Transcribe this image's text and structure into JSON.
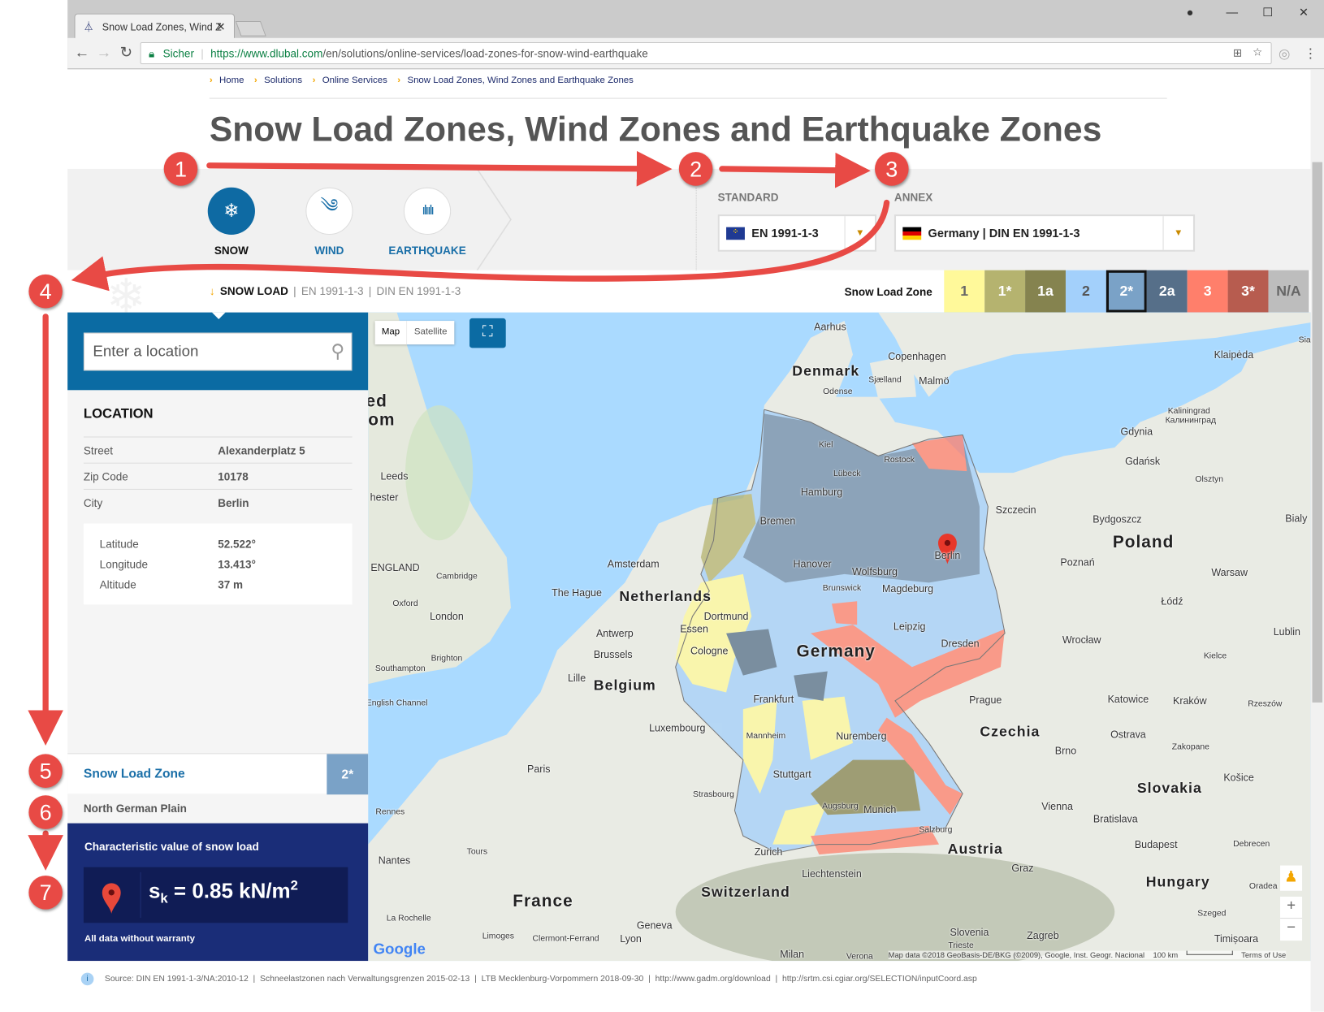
{
  "browser": {
    "tab_title": "Snow Load Zones, Wind Z",
    "tab_close": "✕",
    "secure_label": "Sicher",
    "url_host": "https://www.dlubal.com",
    "url_path": "/en/solutions/online-services/load-zones-for-snow-wind-earthquake"
  },
  "breadcrumb": [
    "Home",
    "Solutions",
    "Online Services",
    "Snow Load Zones, Wind Zones and Earthquake Zones"
  ],
  "page_title": "Snow Load Zones, Wind Zones and Earthquake Zones",
  "load_types": [
    {
      "label": "SNOW",
      "icon": "snowflake-icon",
      "active": true
    },
    {
      "label": "WIND",
      "icon": "wind-icon",
      "active": false
    },
    {
      "label": "EARTHQUAKE",
      "icon": "seismic-wave-icon",
      "active": false
    }
  ],
  "standard": {
    "label": "STANDARD",
    "value": "EN 1991-1-3"
  },
  "annex": {
    "label": "ANNEX",
    "value": "Germany | DIN EN 1991-1-3"
  },
  "subheader": {
    "load": "SNOW LOAD",
    "standard": "EN 1991-1-3",
    "annex": "DIN EN 1991-1-3",
    "sep": "|"
  },
  "zone_legend": {
    "label": "Snow Load Zone",
    "zones": [
      {
        "label": "1",
        "color": "#fff99a",
        "text": "#666"
      },
      {
        "label": "1*",
        "color": "#b5b36f",
        "text": "#fff"
      },
      {
        "label": "1a",
        "color": "#85834f",
        "text": "#fff"
      },
      {
        "label": "2",
        "color": "#a3d0fb",
        "text": "#555"
      },
      {
        "label": "2*",
        "color": "#7aa2c7",
        "text": "#fff",
        "selected": true
      },
      {
        "label": "2a",
        "color": "#566f89",
        "text": "#fff"
      },
      {
        "label": "3",
        "color": "#ff7f6b",
        "text": "#fff"
      },
      {
        "label": "3*",
        "color": "#b75c4f",
        "text": "#fff"
      },
      {
        "label": "N/A",
        "color": "#bdbdbd",
        "text": "#666"
      }
    ]
  },
  "search": {
    "placeholder": "Enter a location"
  },
  "location": {
    "heading": "LOCATION",
    "rows": [
      {
        "label": "Street",
        "value": "Alexanderplatz 5"
      },
      {
        "label": "Zip Code",
        "value": "10178"
      },
      {
        "label": "City",
        "value": "Berlin"
      }
    ],
    "coords": [
      {
        "label": "Latitude",
        "value": "52.522°"
      },
      {
        "label": "Longitude",
        "value": "13.413°"
      },
      {
        "label": "Altitude",
        "value": "37 m"
      }
    ]
  },
  "result": {
    "zone_label": "Snow Load Zone",
    "zone_value": "2*",
    "region": "North German Plain",
    "char_heading": "Characteristic value of snow load",
    "sk_symbol": "s",
    "sk_sub": "k",
    "sk_value": "= 0.85 kN/m",
    "sk_exp": "2",
    "disclaimer": "All data without warranty"
  },
  "map": {
    "type_buttons": [
      "Map",
      "Satellite"
    ],
    "attribution": "Map data ©2018 GeoBasis-DE/BKG (©2009), Google, Inst. Geogr. Nacional",
    "scale": "100 km",
    "terms": "Terms of Use",
    "google": "Google",
    "zoom_in": "+",
    "zoom_out": "−",
    "labels": [
      "Aarhus",
      "Denmark",
      "Copenhagen",
      "Malmö",
      "Sjælland",
      "Odense",
      "Klaipėda",
      "Kaliningrad",
      "Калининград",
      "Gdynia",
      "Gdańsk",
      "Olsztyn",
      "Kiel",
      "Rostock",
      "Lübeck",
      "Hamburg",
      "Bremen",
      "Szczecin",
      "Bydgoszcz",
      "Poland",
      "Berlin",
      "Poznań",
      "Warsaw",
      "Hanover",
      "Wolfsburg",
      "Magdeburg",
      "Brunswick",
      "Amsterdam",
      "The Hague",
      "Netherlands",
      "Łódź",
      "Leipzig",
      "Dortmund",
      "Essen",
      "Antwerp",
      "Lublin",
      "Germany",
      "Dresden",
      "Wrocław",
      "Cologne",
      "Brussels",
      "Kielce",
      "Belgium",
      "Lille",
      "Frankfurt",
      "Prague",
      "Katowice",
      "Kraków",
      "Rzeszów",
      "Czechia",
      "Ostrava",
      "Luxembourg",
      "Mannheim",
      "Nuremberg",
      "Zakopane",
      "Brno",
      "Paris",
      "Stuttgart",
      "Košice",
      "Strasbourg",
      "Slovakia",
      "Vienna",
      "Bratislava",
      "Rennes",
      "Munich",
      "Augsburg",
      "Salzburg",
      "Debrecen",
      "Budapest",
      "Tours",
      "Nantes",
      "Zurich",
      "Austria",
      "Graz",
      "Liechtenstein",
      "Switzerland",
      "Hungary",
      "France",
      "La Rochelle",
      "Geneva",
      "Szeged",
      "Limoges",
      "Clermont-Ferrand",
      "Lyon",
      "Slovenia",
      "Zagreb",
      "Timișoara",
      "Trieste",
      "Milan",
      "Verona",
      "Leeds",
      "hester",
      "ENGLAND",
      "Cambridge",
      "Oxford",
      "London",
      "Brighton",
      "Southampton",
      "ed",
      "om",
      "English Channel",
      "Oradea",
      "Bialy",
      "Sia"
    ]
  },
  "footer": {
    "source": "Source: DIN EN 1991-1-3/NA:2010-12  |  Schneelastzonen nach Verwaltungsgrenzen 2015-02-13  |  LTB Mecklenburg-Vorpommern 2018-09-30  |  http://www.gadm.org/download  |  http://srtm.csi.cgiar.org/SELECTION/inputCoord.asp"
  },
  "annotations": [
    "1",
    "2",
    "3",
    "4",
    "5",
    "6",
    "7"
  ]
}
